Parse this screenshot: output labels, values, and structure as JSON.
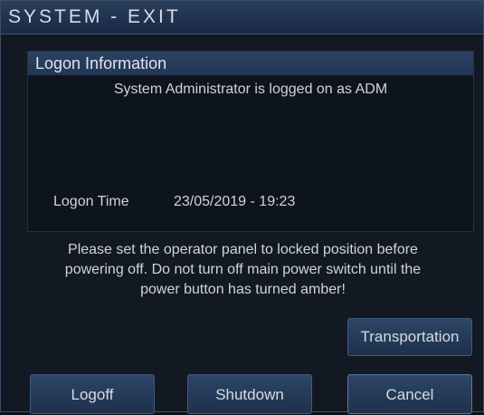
{
  "window": {
    "title": "SYSTEM - EXIT"
  },
  "logon_panel": {
    "header": "Logon Information",
    "message": "System Administrator is logged on as ADM",
    "time_label": "Logon Time",
    "time_value": "23/05/2019 - 19:23"
  },
  "warning": {
    "line1": "Please set the operator panel to locked position before",
    "line2": "powering off. Do not turn off main power switch until the",
    "line3": "power button has turned amber!"
  },
  "buttons": {
    "transportation": "Transportation",
    "logoff": "Logoff",
    "shutdown": "Shutdown",
    "cancel": "Cancel"
  }
}
